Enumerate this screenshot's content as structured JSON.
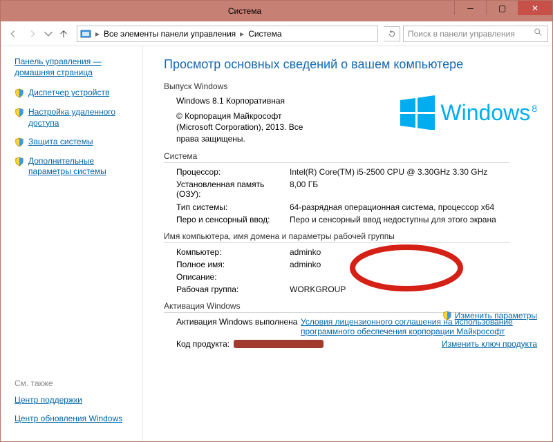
{
  "window": {
    "title": "Система"
  },
  "toolbar": {
    "breadcrumb": {
      "root_icon": "control-panel",
      "part1": "Все элементы панели управления",
      "part2": "Система"
    },
    "search_placeholder": "Поиск в панели управления"
  },
  "sidebar": {
    "home": "Панель управления — домашняя страница",
    "items": [
      {
        "label": "Диспетчер устройств",
        "shield": true
      },
      {
        "label": "Настройка удаленного доступа",
        "shield": true
      },
      {
        "label": "Защита системы",
        "shield": true
      },
      {
        "label": "Дополнительные параметры системы",
        "shield": true
      }
    ],
    "see_also_title": "См. также",
    "see_also": [
      {
        "label": "Центр поддержки"
      },
      {
        "label": "Центр обновления Windows"
      }
    ]
  },
  "page": {
    "heading": "Просмотр основных сведений о вашем компьютере",
    "edition_section": "Выпуск Windows",
    "edition_name": "Windows 8.1 Корпоративная",
    "copyright": "© Корпорация Майкрософт (Microsoft Corporation), 2013. Все права защищены.",
    "logo_text": "Windows",
    "logo_suffix": "8",
    "system_section": "Система",
    "system": {
      "cpu_k": "Процессор:",
      "cpu_v": "Intel(R) Core(TM) i5-2500 CPU @ 3.30GHz   3.30 GHz",
      "ram_k": "Установленная память (ОЗУ):",
      "ram_v": "8,00 ГБ",
      "type_k": "Тип системы:",
      "type_v": "64-разрядная операционная система, процессор x64",
      "pen_k": "Перо и сенсорный ввод:",
      "pen_v": "Перо и сенсорный ввод недоступны для этого экрана"
    },
    "name_section": "Имя компьютера, имя домена и параметры рабочей группы",
    "name": {
      "comp_k": "Компьютер:",
      "comp_v": "adminko",
      "full_k": "Полное имя:",
      "full_v": "adminko",
      "desc_k": "Описание:",
      "desc_v": "",
      "wg_k": "Рабочая группа:",
      "wg_v": "WORKGROUP"
    },
    "change_params": "Изменить параметры",
    "activation_section": "Активация Windows",
    "activation_status": "Активация Windows выполнена",
    "license_link": "Условия лицензионного соглашения на использование программного обеспечения корпорации Майкрософт",
    "product_key_k": "Код продукта:",
    "change_key": "Изменить ключ продукта"
  }
}
